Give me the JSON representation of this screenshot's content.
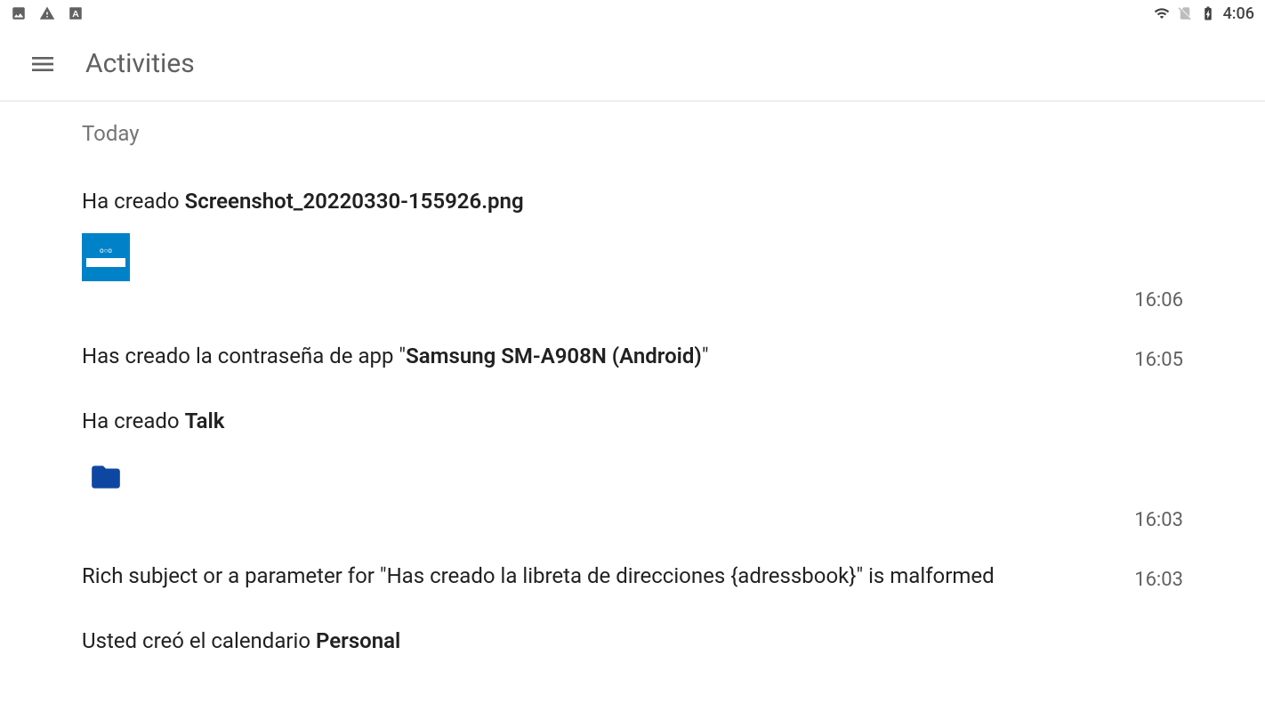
{
  "status_bar": {
    "time": "4:06"
  },
  "header": {
    "title": "Activities"
  },
  "section": {
    "label": "Today"
  },
  "activities": [
    {
      "prefix": "Ha creado ",
      "bold": "Screenshot_20220330-155926.png",
      "suffix": "",
      "time": "16:06",
      "thumb_type": "screenshot"
    },
    {
      "prefix": "Has creado la contraseña de app \"",
      "bold": "Samsung SM-A908N (Android)",
      "suffix": "\"",
      "time": "16:05",
      "thumb_type": "none"
    },
    {
      "prefix": "Ha creado ",
      "bold": "Talk",
      "suffix": "",
      "time": "16:03",
      "thumb_type": "folder"
    },
    {
      "prefix": "Rich subject or a parameter for \"Has creado la libreta de direcciones {adressbook}\" is malformed",
      "bold": "",
      "suffix": "",
      "time": "16:03",
      "thumb_type": "none"
    },
    {
      "prefix": "Usted creó el calendario ",
      "bold": "Personal",
      "suffix": "",
      "time": "",
      "thumb_type": "none"
    }
  ]
}
